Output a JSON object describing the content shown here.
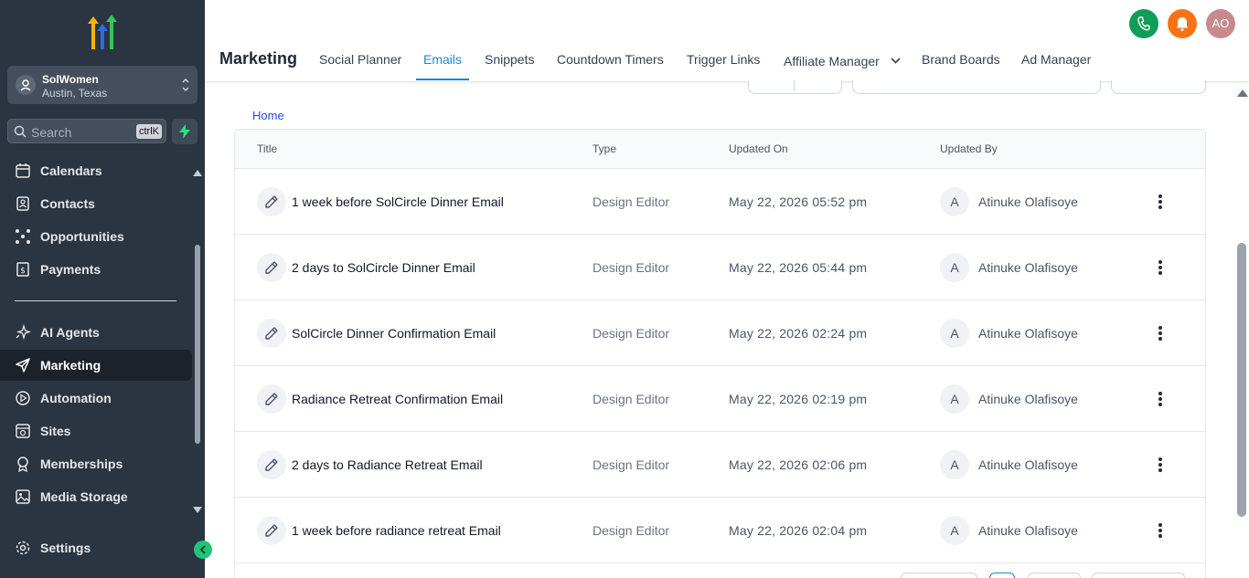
{
  "account": {
    "name": "SolWomen",
    "location": "Austin, Texas"
  },
  "search": {
    "placeholder": "Search",
    "shortcut": "ctrlK"
  },
  "sidebar": {
    "items": [
      {
        "label": "Calendars",
        "icon": "calendar-icon"
      },
      {
        "label": "Contacts",
        "icon": "contacts-icon"
      },
      {
        "label": "Opportunities",
        "icon": "opportunities-icon"
      },
      {
        "label": "Payments",
        "icon": "payments-icon"
      },
      {
        "label": "AI Agents",
        "icon": "sparkle-icon"
      },
      {
        "label": "Marketing",
        "icon": "send-icon",
        "active": true
      },
      {
        "label": "Automation",
        "icon": "automation-icon"
      },
      {
        "label": "Sites",
        "icon": "sites-icon"
      },
      {
        "label": "Memberships",
        "icon": "award-icon"
      },
      {
        "label": "Media Storage",
        "icon": "image-icon"
      }
    ],
    "settings_label": "Settings"
  },
  "header": {
    "title": "Marketing",
    "user_initials": "AO",
    "tabs": [
      {
        "label": "Social Planner"
      },
      {
        "label": "Emails",
        "active": true
      },
      {
        "label": "Snippets"
      },
      {
        "label": "Countdown Timers"
      },
      {
        "label": "Trigger Links"
      },
      {
        "label": "Affiliate Manager",
        "dropdown": true
      },
      {
        "label": "Brand Boards"
      },
      {
        "label": "Ad Manager"
      }
    ]
  },
  "breadcrumb": "Home",
  "table": {
    "columns": [
      "Title",
      "Type",
      "Updated On",
      "Updated By"
    ],
    "rows": [
      {
        "title": "1 week before SolCircle Dinner Email",
        "type": "Design Editor",
        "updated_on": "May 22, 2026 05:52 pm",
        "initial": "A",
        "updated_by": "Atinuke Olafisoye"
      },
      {
        "title": "2 days to SolCircle Dinner Email",
        "type": "Design Editor",
        "updated_on": "May 22, 2026 05:44 pm",
        "initial": "A",
        "updated_by": "Atinuke Olafisoye"
      },
      {
        "title": "SolCircle Dinner Confirmation Email",
        "type": "Design Editor",
        "updated_on": "May 22, 2026 02:24 pm",
        "initial": "A",
        "updated_by": "Atinuke Olafisoye"
      },
      {
        "title": "Radiance Retreat Confirmation Email",
        "type": "Design Editor",
        "updated_on": "May 22, 2026 02:19 pm",
        "initial": "A",
        "updated_by": "Atinuke Olafisoye"
      },
      {
        "title": "2 days to Radiance Retreat Email",
        "type": "Design Editor",
        "updated_on": "May 22, 2026 02:06 pm",
        "initial": "A",
        "updated_by": "Atinuke Olafisoye"
      },
      {
        "title": "1 week before radiance retreat Email",
        "type": "Design Editor",
        "updated_on": "May 22, 2026 02:04 pm",
        "initial": "A",
        "updated_by": "Atinuke Olafisoye"
      }
    ]
  },
  "colors": {
    "sidebar_bg": "#2b3441",
    "accent": "#1a88d6",
    "phone": "#0f9d58",
    "bell": "#f97316",
    "avatar": "#c98a8f"
  }
}
